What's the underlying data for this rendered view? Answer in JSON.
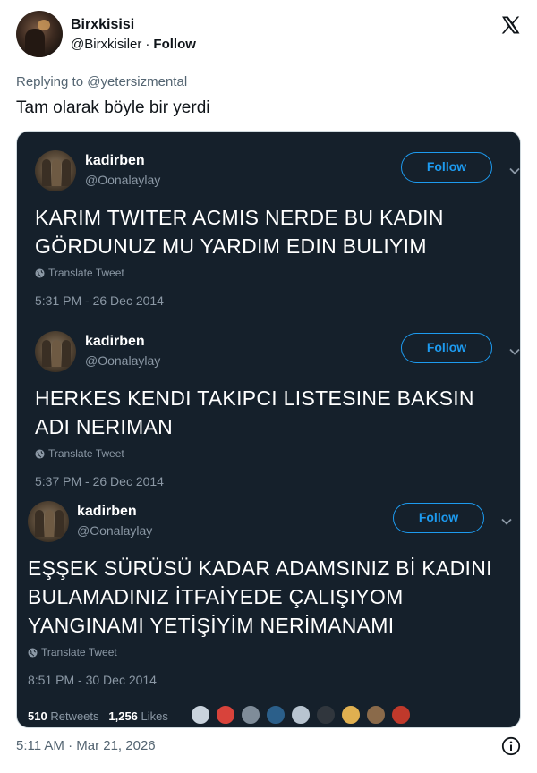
{
  "author": {
    "display_name": "Birxkisisi",
    "handle": "@Birxkisiler",
    "separator": "·",
    "follow_label": "Follow"
  },
  "platform_icon": "x-logo-icon",
  "reply": {
    "prefix": "Replying to",
    "mention": "@yetersizmental"
  },
  "tweet_text": "Tam olarak böyle bir yerdi",
  "screenshot": {
    "theme_color": "#15202b",
    "accent": "#1d9bf0",
    "tweets": [
      {
        "name": "kadirben",
        "handle": "@Oonalaylay",
        "follow_label": "Follow",
        "lines": [
          "KARIM TWITER ACMIS NERDE BU KADIN",
          "GÖRDUNUZ MU YARDIM EDIN BULIYIM"
        ],
        "translate_label": "Translate Tweet",
        "time": "5:31 PM - 26 Dec 2014"
      },
      {
        "name": "kadirben",
        "handle": "@Oonalaylay",
        "follow_label": "Follow",
        "lines": [
          "HERKES KENDI TAKIPCI LISTESINE BAKSIN",
          "ADI NERIMAN"
        ],
        "translate_label": "Translate Tweet",
        "time": "5:37 PM - 26 Dec 2014"
      },
      {
        "name": "kadirben",
        "handle": "@Oonalaylay",
        "follow_label": "Follow",
        "lines": [
          "EŞŞEK SÜRÜSÜ KADAR ADAMSINIZ Bİ KADINI",
          "BULAMADINIZ İTFAİYEDE ÇALIŞIYOM",
          "YANGINAMI YETİŞİYİM NERİMANAMI"
        ],
        "translate_label": "Translate Tweet",
        "time": "8:51 PM - 30 Dec 2014"
      }
    ],
    "stats": {
      "retweets_count": "510",
      "retweets_label": "Retweets",
      "likes_count": "1,256",
      "likes_label": "Likes"
    },
    "liker_colors": [
      "#c9d3dd",
      "#d8433b",
      "#7f8c99",
      "#2b5f8a",
      "#b8c4d0",
      "#30363d",
      "#e0b050",
      "#8a6a4a",
      "#c0392b"
    ]
  },
  "footer": {
    "timestamp": "5:11 AM · Mar 21, 2026",
    "info_icon": "info-icon"
  }
}
